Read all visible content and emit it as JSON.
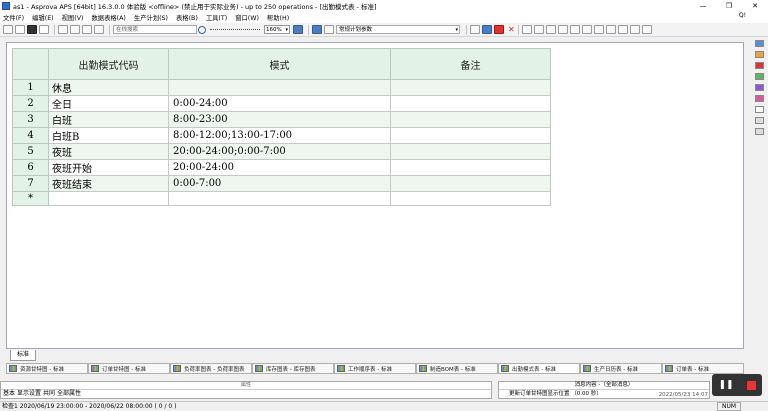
{
  "window": {
    "title": "as1 - Asprova APS [64bit] 16.3.0.0 体验版 <offline> (禁止用于实际业务) - up to 250 operations - [出勤模式表 - 标准]",
    "controls": [
      "—",
      "❐",
      "✕"
    ]
  },
  "menubar": {
    "items": [
      "文件(F)",
      "编辑(E)",
      "视图(V)",
      "数据表格(A)",
      "生产计划(S)",
      "表格(B)",
      "工具(T)",
      "窗口(W)",
      "帮助(H)"
    ],
    "user": "Q!"
  },
  "toolbar": {
    "search_placeholder": "在线搜索",
    "zoom": "160%",
    "plan_combo": "常规计划参数"
  },
  "grid": {
    "columns": [
      "出勤模式代码",
      "模式",
      "备注"
    ],
    "rows": [
      {
        "num": "1",
        "code": "休息",
        "mode": "",
        "note": ""
      },
      {
        "num": "2",
        "code": "全日",
        "mode": "0:00-24:00",
        "note": ""
      },
      {
        "num": "3",
        "code": "白班",
        "mode": "8:00-23:00",
        "note": ""
      },
      {
        "num": "4",
        "code": "白班B",
        "mode": "8:00-12:00;13:00-17:00",
        "note": ""
      },
      {
        "num": "5",
        "code": "夜班",
        "mode": "20:00-24:00;0:00-7:00",
        "note": ""
      },
      {
        "num": "6",
        "code": "夜班开始",
        "mode": "20:00-24:00",
        "note": ""
      },
      {
        "num": "7",
        "code": "夜班结束",
        "mode": "0:00-7:00",
        "note": ""
      },
      {
        "num": "*",
        "code": "",
        "mode": "",
        "note": ""
      }
    ]
  },
  "sheet_tab": "标准",
  "window_tabs": [
    "资源甘特图 - 标准",
    "订单甘特图 - 标准",
    "负荷率图表 - 负荷率图表",
    "库存图表 - 库存图表",
    "工作顺序表 - 标准",
    "制造BOM表 - 标准",
    "出勤模式表 - 标准",
    "生产日历表 - 标准",
    "订单表 - 标准"
  ],
  "bottom": {
    "property_header": "属性",
    "property_tabs": [
      "基本",
      "显示设置",
      "共同",
      "全部属性"
    ],
    "message_header": "消息内容 -（全部消息）",
    "message": "更新订单甘特图显示位置 （0.00 秒）",
    "message_date": "2022/05/23 14:07"
  },
  "status": {
    "text": "检查1 2020/06/19 23:00:00 - 2020/06/22 08:00:00 ( 0 / 0 )",
    "num": "NUM"
  }
}
